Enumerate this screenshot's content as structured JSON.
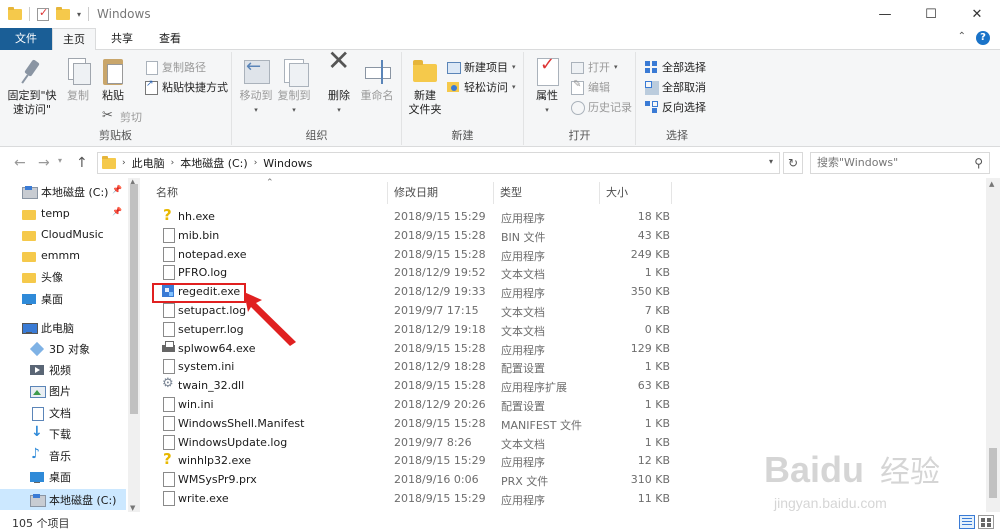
{
  "window": {
    "title": "Windows",
    "controls": {
      "minimize": "—",
      "maximize": "☐",
      "close": "✕"
    }
  },
  "tabs": {
    "file": "文件",
    "home": "主页",
    "share": "共享",
    "view": "查看"
  },
  "ribbon": {
    "clipboard": {
      "label": "剪贴板",
      "pin_quick_access": "固定到\"快速访问\"",
      "copy": "复制",
      "paste": "粘贴",
      "copy_path": "复制路径",
      "paste_shortcut": "粘贴快捷方式",
      "cut": "剪切"
    },
    "organize": {
      "label": "组织",
      "move_to": "移动到",
      "copy_to": "复制到",
      "delete": "删除",
      "rename": "重命名"
    },
    "new": {
      "label": "新建",
      "new_folder": "新建\n文件夹",
      "new_item": "新建项目",
      "easy_access": "轻松访问"
    },
    "open": {
      "label": "打开",
      "properties": "属性",
      "open": "打开",
      "edit": "编辑",
      "history": "历史记录"
    },
    "select": {
      "label": "选择",
      "select_all": "全部选择",
      "select_none": "全部取消",
      "invert": "反向选择"
    }
  },
  "address": {
    "crumbs": [
      "此电脑",
      "本地磁盘 (C:)",
      "Windows"
    ],
    "search_placeholder": "搜索\"Windows\""
  },
  "nav": {
    "items": [
      {
        "label": "本地磁盘 (C:)",
        "icon": "drive-icon",
        "pinned": true
      },
      {
        "label": "temp",
        "icon": "folder-icon",
        "pinned": true
      },
      {
        "label": "CloudMusic",
        "icon": "folder-icon"
      },
      {
        "label": "emmm",
        "icon": "folder-icon"
      },
      {
        "label": "头像",
        "icon": "folder-icon"
      },
      {
        "label": "桌面",
        "icon": "desktop-icon"
      },
      {
        "label": "此电脑",
        "icon": "pc-icon"
      },
      {
        "label": "3D 对象",
        "icon": "3d-objects-icon"
      },
      {
        "label": "视频",
        "icon": "video-icon"
      },
      {
        "label": "图片",
        "icon": "pictures-icon"
      },
      {
        "label": "文档",
        "icon": "documents-icon"
      },
      {
        "label": "下载",
        "icon": "downloads-icon"
      },
      {
        "label": "音乐",
        "icon": "music-icon"
      },
      {
        "label": "桌面",
        "icon": "desktop-icon"
      },
      {
        "label": "本地磁盘 (C:)",
        "icon": "drive-icon",
        "selected": true
      }
    ]
  },
  "columns": {
    "name": "名称",
    "date": "修改日期",
    "type": "类型",
    "size": "大小"
  },
  "files": [
    {
      "name": "hh.exe",
      "date": "2018/9/15 15:29",
      "type": "应用程序",
      "size": "18 KB",
      "icon": "help-icon"
    },
    {
      "name": "mib.bin",
      "date": "2018/9/15 15:28",
      "type": "BIN 文件",
      "size": "43 KB",
      "icon": "file-icon"
    },
    {
      "name": "notepad.exe",
      "date": "2018/9/15 15:28",
      "type": "应用程序",
      "size": "249 KB",
      "icon": "notepad-icon"
    },
    {
      "name": "PFRO.log",
      "date": "2018/12/9 19:52",
      "type": "文本文档",
      "size": "1 KB",
      "icon": "file-icon"
    },
    {
      "name": "regedit.exe",
      "date": "2018/12/9 19:33",
      "type": "应用程序",
      "size": "350 KB",
      "icon": "regedit-icon"
    },
    {
      "name": "setupact.log",
      "date": "2019/9/7 17:15",
      "type": "文本文档",
      "size": "7 KB",
      "icon": "file-icon"
    },
    {
      "name": "setuperr.log",
      "date": "2018/12/9 19:18",
      "type": "文本文档",
      "size": "0 KB",
      "icon": "file-icon"
    },
    {
      "name": "splwow64.exe",
      "date": "2018/9/15 15:28",
      "type": "应用程序",
      "size": "129 KB",
      "icon": "printer-icon"
    },
    {
      "name": "system.ini",
      "date": "2018/12/9 18:28",
      "type": "配置设置",
      "size": "1 KB",
      "icon": "settings-file-icon"
    },
    {
      "name": "twain_32.dll",
      "date": "2018/9/15 15:28",
      "type": "应用程序扩展",
      "size": "63 KB",
      "icon": "gear-icon"
    },
    {
      "name": "win.ini",
      "date": "2018/12/9 20:26",
      "type": "配置设置",
      "size": "1 KB",
      "icon": "settings-file-icon"
    },
    {
      "name": "WindowsShell.Manifest",
      "date": "2018/9/15 15:28",
      "type": "MANIFEST 文件",
      "size": "1 KB",
      "icon": "file-icon"
    },
    {
      "name": "WindowsUpdate.log",
      "date": "2019/9/7 8:26",
      "type": "文本文档",
      "size": "1 KB",
      "icon": "file-icon"
    },
    {
      "name": "winhlp32.exe",
      "date": "2018/9/15 15:29",
      "type": "应用程序",
      "size": "12 KB",
      "icon": "help-icon"
    },
    {
      "name": "WMSysPr9.prx",
      "date": "2018/9/16 0:06",
      "type": "PRX 文件",
      "size": "310 KB",
      "icon": "file-icon"
    },
    {
      "name": "write.exe",
      "date": "2018/9/15 15:29",
      "type": "应用程序",
      "size": "11 KB",
      "icon": "file-icon"
    }
  ],
  "status": {
    "count": "105 个项目"
  },
  "colors": {
    "file_tab": "#1a5e96",
    "selection": "#cce8ff",
    "highlight": "#e02020"
  },
  "watermark": {
    "brand": "Baidu",
    "brand_cn": "经验",
    "url": "jingyan.baidu.com"
  }
}
